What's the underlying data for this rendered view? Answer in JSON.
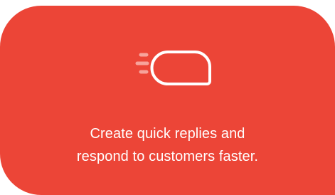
{
  "card": {
    "icon": "quick-reply-chat-bubble-icon",
    "message_line_1": "Create quick replies and",
    "message_line_2": "respond to customers faster.",
    "background_color": "#ec4537",
    "text_color": "#ffffff",
    "icon_accent_color": "#f7a39b"
  }
}
